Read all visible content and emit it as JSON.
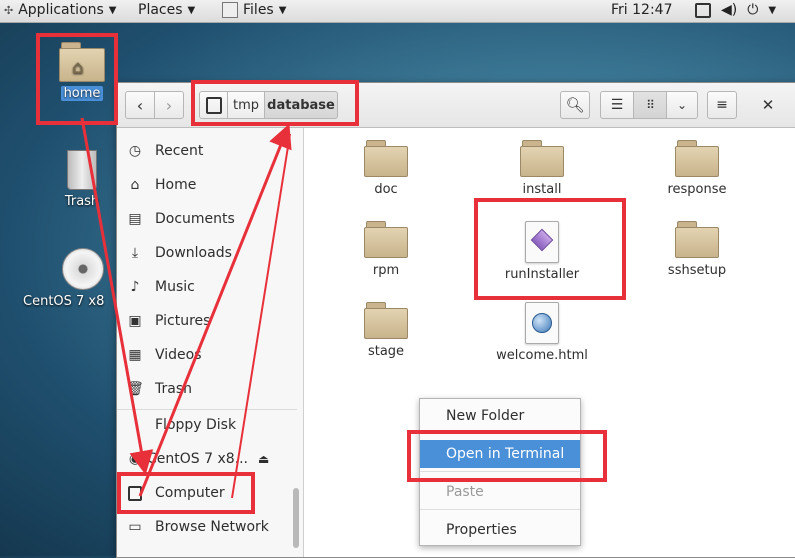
{
  "topbar": {
    "applications": "Applications",
    "places": "Places",
    "files": "Files",
    "clock": "Fri 12:47"
  },
  "desktop": {
    "home": "home",
    "trash": "Trash",
    "centos": "CentOS 7 x8"
  },
  "breadcrumb": [
    "tmp",
    "database"
  ],
  "sidebar": {
    "items": [
      "Recent",
      "Home",
      "Documents",
      "Downloads",
      "Music",
      "Pictures",
      "Videos",
      "Trash"
    ],
    "devices": [
      "Floppy Disk",
      "CentOS 7 x8...",
      "Computer"
    ],
    "partial": "Browse Network"
  },
  "files": [
    {
      "name": "doc",
      "kind": "folder"
    },
    {
      "name": "install",
      "kind": "folder"
    },
    {
      "name": "response",
      "kind": "folder"
    },
    {
      "name": "rpm",
      "kind": "folder"
    },
    {
      "name": "runInstaller",
      "kind": "script"
    },
    {
      "name": "sshsetup",
      "kind": "folder"
    },
    {
      "name": "stage",
      "kind": "folder"
    },
    {
      "name": "welcome.html",
      "kind": "html"
    }
  ],
  "context_menu": {
    "new_folder": "New Folder",
    "open_terminal": "Open in Terminal",
    "paste": "Paste",
    "properties": "Properties"
  },
  "colors": {
    "annotation": "#e8303a",
    "highlight": "#4a90d9"
  }
}
